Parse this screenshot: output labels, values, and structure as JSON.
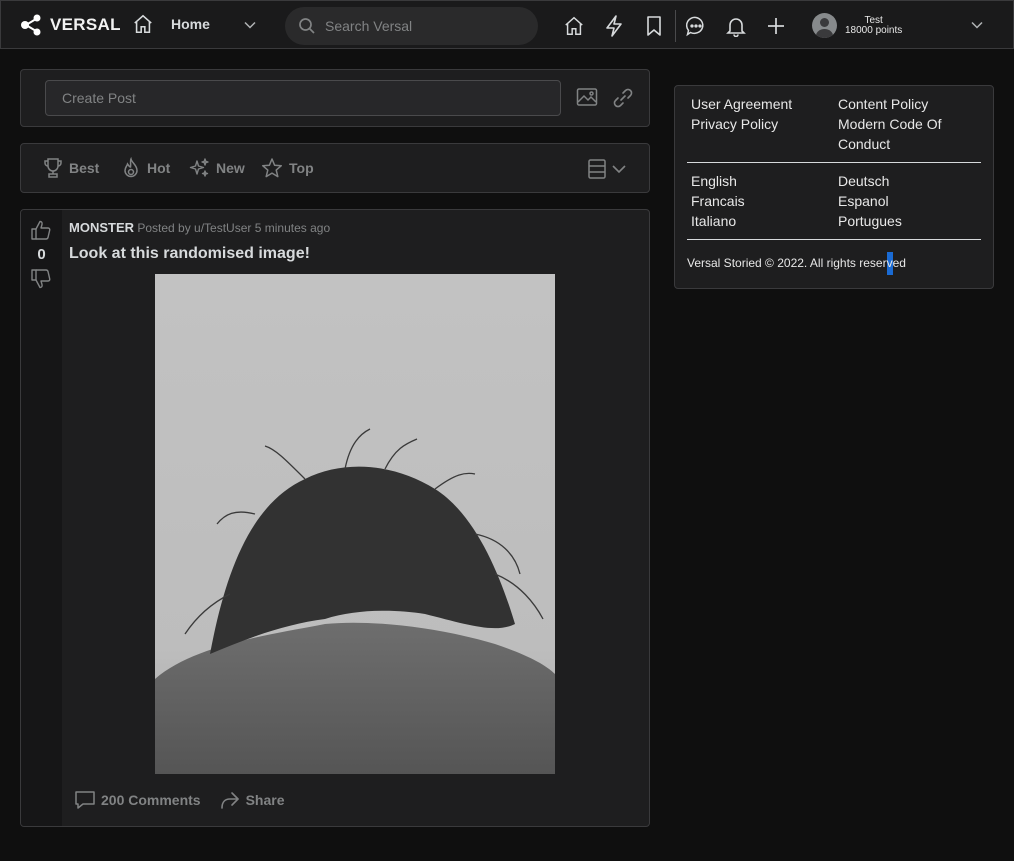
{
  "header": {
    "logo_text": "VERSAL",
    "home_label": "Home",
    "search_placeholder": "Search Versal",
    "user_name": "Test",
    "user_points": "18000 points",
    "icons": [
      "home-icon",
      "lightning-icon",
      "bookmark-icon",
      "chat-icon",
      "bell-icon",
      "plus-icon",
      "chevron-down-icon"
    ]
  },
  "create_post": {
    "placeholder": "Create Post",
    "icons": [
      "image-icon",
      "link-icon"
    ]
  },
  "sort": {
    "best": "Best",
    "hot": "Hot",
    "new": "New",
    "top": "Top"
  },
  "post": {
    "vote_count": "0",
    "subreddit": "MONSTER",
    "posted_by": "Posted by u/TestUser",
    "time": "5 minutes ago",
    "title": "Look at this randomised image!",
    "comments_label": "200 Comments",
    "share_label": "Share"
  },
  "sidebar": {
    "links": {
      "user_agreement": "User Agreement",
      "content_policy": "Content Policy",
      "privacy_policy": "Privacy Policy",
      "modern_code_1": "Modern Code Of",
      "modern_code_2": "Conduct"
    },
    "languages": {
      "english": "English",
      "deutsch": "Deutsch",
      "francais": "Francais",
      "espanol": "Espanol",
      "italiano": "Italiano",
      "portugues": "Portugues"
    },
    "copyright": "Versal Storied © 2022. All rights reserved"
  },
  "colors": {
    "background": "#0f0f0f",
    "card": "#1e1e1f",
    "border": "#3a3a3c",
    "text": "#d7dadc",
    "muted": "#818384",
    "cursor": "#1a73e8"
  }
}
